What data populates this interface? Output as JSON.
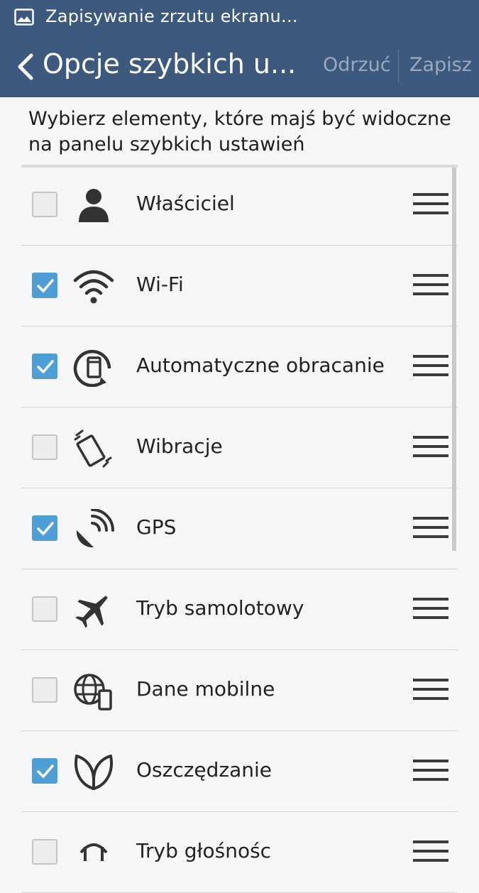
{
  "status_bar": {
    "notification_text": "Zapisywanie zrzutu ekranu...",
    "icon": "image-icon"
  },
  "action_bar": {
    "title": "Opcje szybkich u...",
    "discard_label": "Odrzuć",
    "save_label": "Zapisz",
    "back_icon": "chevron-left-icon"
  },
  "instructions": "Wybierz elementy, które majś być widoczne na panelu szybkich ustawień",
  "colors": {
    "action_bar": "#3d5a7e",
    "checkbox_checked": "#4f9ed6",
    "background": "#f6f6f6"
  },
  "items": [
    {
      "label": "Właściciel",
      "checked": false,
      "icon": "person-icon"
    },
    {
      "label": "Wi-Fi",
      "checked": true,
      "icon": "wifi-icon"
    },
    {
      "label": "Automatyczne obracanie",
      "checked": true,
      "icon": "auto-rotate-icon"
    },
    {
      "label": "Wibracje",
      "checked": false,
      "icon": "vibrate-icon"
    },
    {
      "label": "GPS",
      "checked": true,
      "icon": "gps-satellite-icon"
    },
    {
      "label": "Tryb samolotowy",
      "checked": false,
      "icon": "airplane-icon"
    },
    {
      "label": "Dane mobilne",
      "checked": false,
      "icon": "mobile-data-icon"
    },
    {
      "label": "Oszczędzanie",
      "checked": true,
      "icon": "leaf-icon"
    },
    {
      "label": "Tryb głośnośc",
      "checked": false,
      "icon": "sound-mode-icon"
    }
  ]
}
